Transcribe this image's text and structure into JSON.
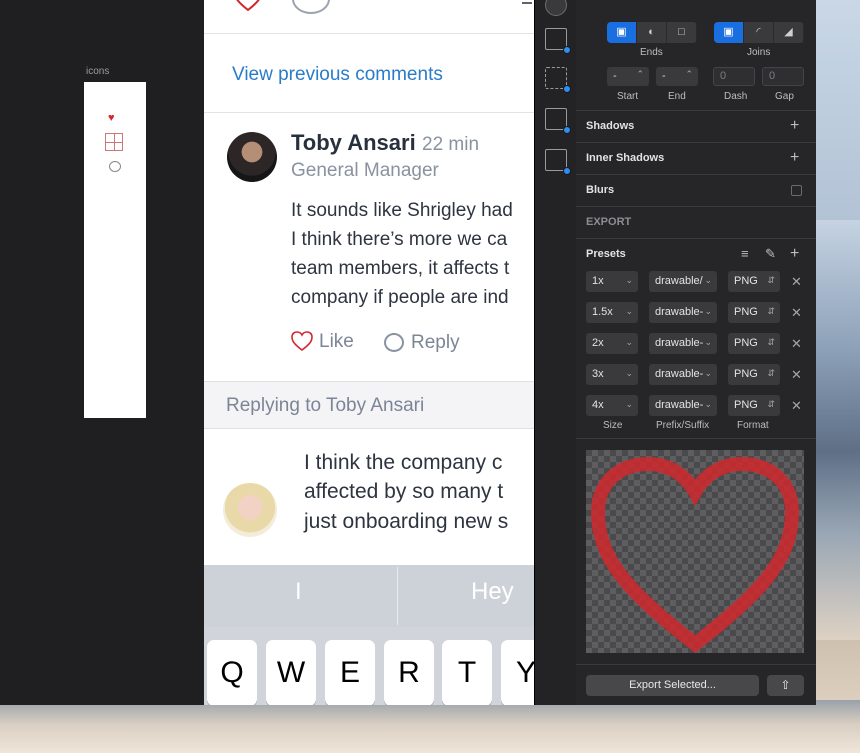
{
  "canvas": {
    "artboard_label": "icons"
  },
  "phone": {
    "view_previous": "View previous comments",
    "comment": {
      "author": "Toby Ansari",
      "time": "22 min",
      "role": "General Manager",
      "lines": [
        "It sounds like Shrigley had",
        "I think there’s more we ca",
        "team members, it affects t",
        "company if people are ind"
      ],
      "like_label": "Like",
      "reply_label": "Reply"
    },
    "replying_to": "Replying to Toby Ansari",
    "compose_lines": [
      "I think the company c",
      "affected by so many t",
      "just onboarding new s"
    ],
    "suggestions": [
      "I",
      "Hey"
    ],
    "keys": [
      "Q",
      "W",
      "E",
      "R",
      "T",
      "Y"
    ]
  },
  "inspector": {
    "border": {
      "ends_label": "Ends",
      "joins_label": "Joins",
      "start_value": "-",
      "end_value": "-",
      "dash_placeholder": "0",
      "gap_placeholder": "0",
      "start_label": "Start",
      "end_label": "End",
      "dash_label": "Dash",
      "gap_label": "Gap"
    },
    "shadows": "Shadows",
    "inner_shadows": "Inner Shadows",
    "blurs": "Blurs",
    "export_header": "EXPORT",
    "presets_label": "Presets",
    "rows": [
      {
        "size": "1x",
        "prefix": "drawable/",
        "format": "PNG"
      },
      {
        "size": "1.5x",
        "prefix": "drawable-",
        "format": "PNG"
      },
      {
        "size": "2x",
        "prefix": "drawable-",
        "format": "PNG"
      },
      {
        "size": "3x",
        "prefix": "drawable-",
        "format": "PNG"
      },
      {
        "size": "4x",
        "prefix": "drawable-",
        "format": "PNG"
      }
    ],
    "col_size": "Size",
    "col_prefix": "Prefix/Suffix",
    "col_format": "Format",
    "export_selected": "Export Selected...",
    "colors": {
      "accent": "#1a6fe0",
      "heart": "#d0282e"
    }
  }
}
